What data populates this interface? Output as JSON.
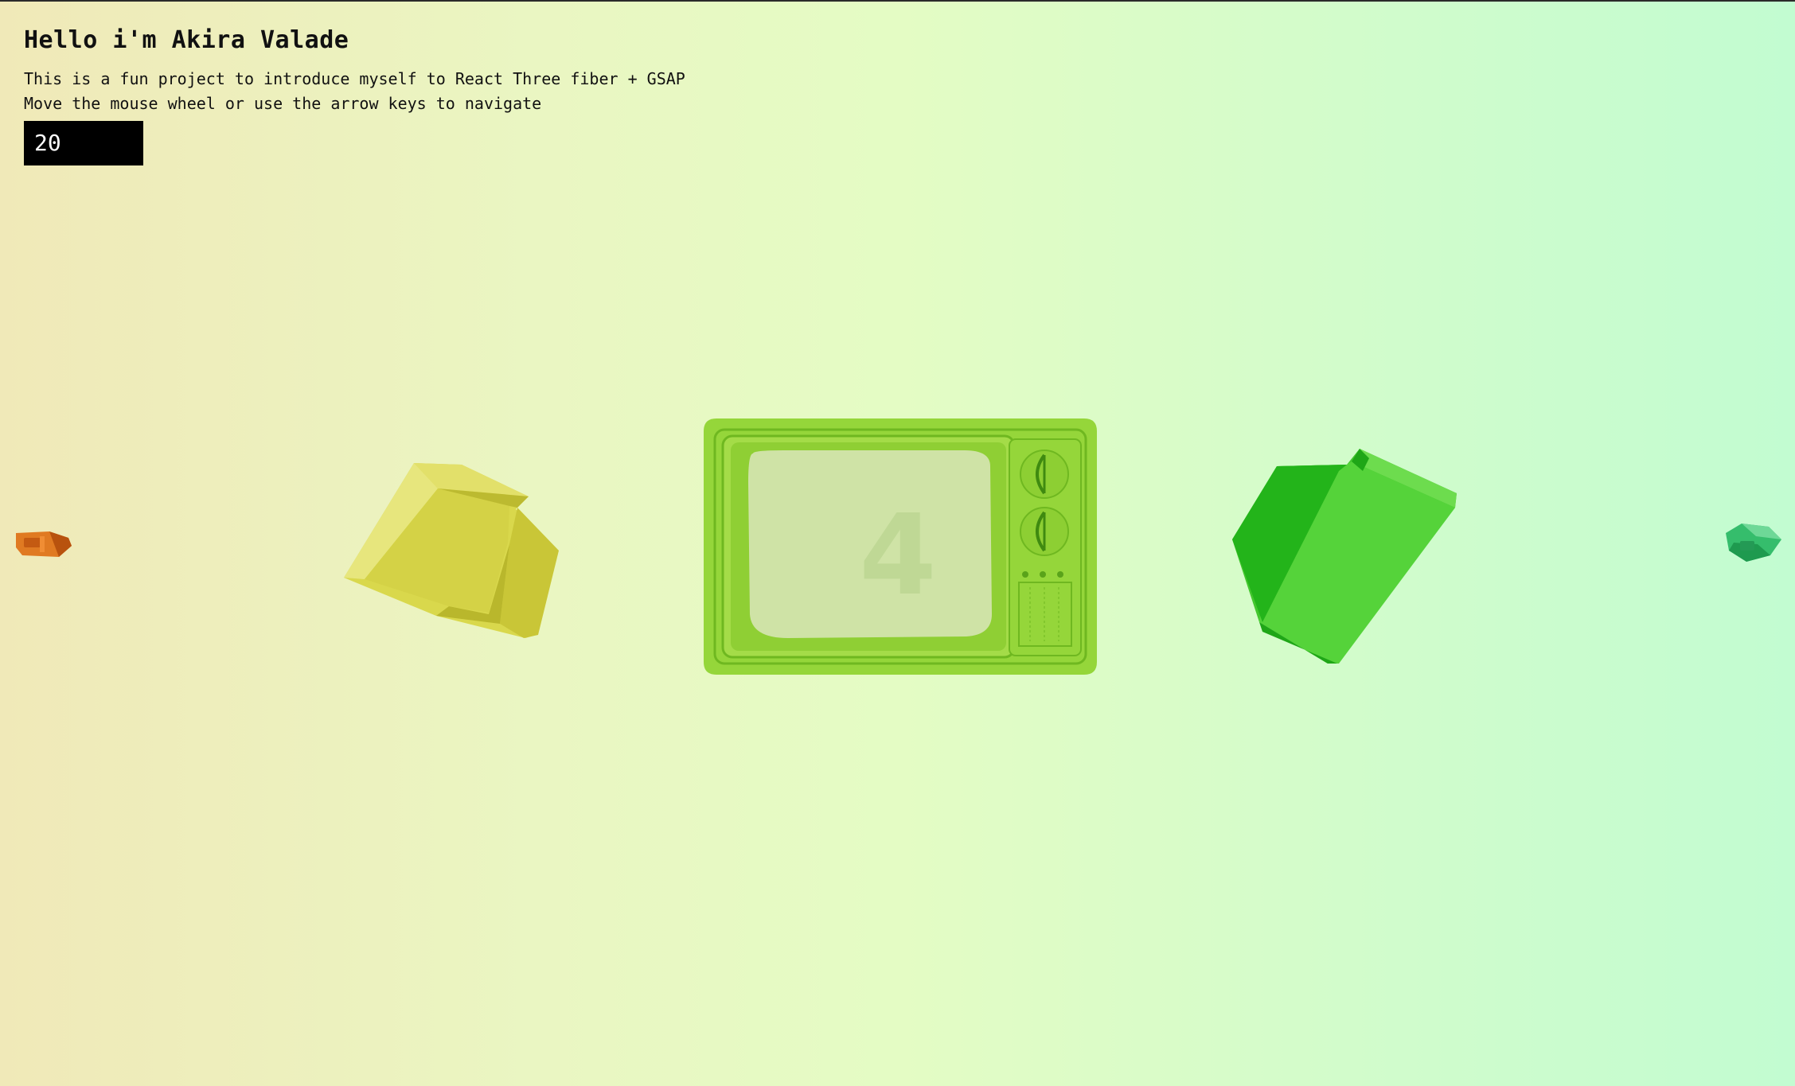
{
  "intro": {
    "title": "Hello i'm Akira Valade",
    "line1": "This is a fun project to introduce myself to React Three fiber + GSAP",
    "line2": "Move the mouse wheel or use the arrow keys to navigate"
  },
  "counter": {
    "value": "20"
  },
  "carousel": {
    "items": [
      {
        "name": "orange-tv",
        "color": "#d9661a"
      },
      {
        "name": "yellow-tv",
        "color": "#d6d448"
      },
      {
        "name": "center-tv",
        "color": "#9ad63f",
        "screen_label": "4"
      },
      {
        "name": "green-tv",
        "color": "#3ecb2c"
      },
      {
        "name": "emerald-tv",
        "color": "#2fb865"
      }
    ]
  },
  "colors": {
    "background_left": "#f0e9b8",
    "background_right": "#c2fcd1",
    "counter_bg": "#000000",
    "counter_text": "#ffffff"
  }
}
